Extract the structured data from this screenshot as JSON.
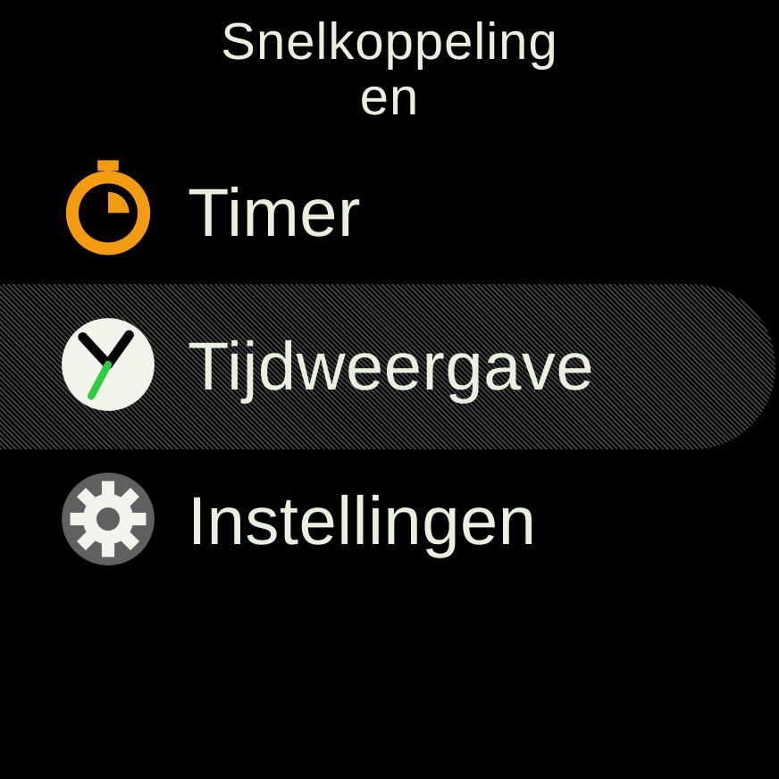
{
  "header": {
    "title_line1": "Snelkoppeling",
    "title_line2": "en"
  },
  "menu": {
    "items": [
      {
        "icon": "timer-icon",
        "label": "Timer",
        "selected": false
      },
      {
        "icon": "watch-icon",
        "label": "Tijdweergave",
        "selected": true
      },
      {
        "icon": "gear-icon",
        "label": "Instellingen",
        "selected": false
      }
    ]
  },
  "colors": {
    "orange": "#f39c12",
    "black": "#000000",
    "white": "#f0f4eb",
    "green": "#2ecc40",
    "grey": "#606060"
  }
}
